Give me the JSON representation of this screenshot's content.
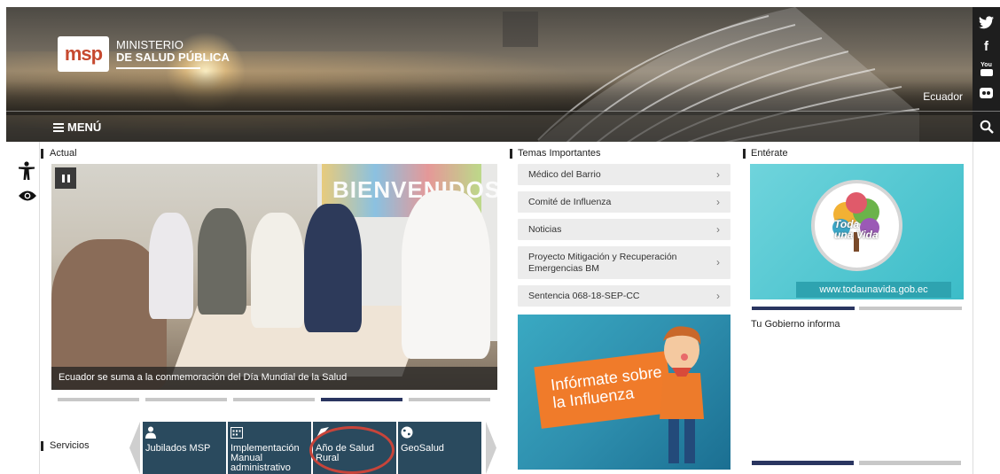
{
  "header": {
    "logo_mark": "msp",
    "org_line1": "MINISTERIO",
    "org_line2": "DE SALUD PÚBLICA",
    "country": "Ecuador",
    "menu_label": "MENÚ"
  },
  "social": {
    "icons": [
      "twitter-icon",
      "facebook-icon",
      "youtube-icon",
      "flickr-icon",
      "search-icon"
    ],
    "youtube_text": "You"
  },
  "sections": {
    "actual": "Actual",
    "servicios": "Servicios",
    "temas": "Temas Importantes",
    "enterate": "Entérate",
    "gobierno": "Tu Gobierno informa"
  },
  "slider": {
    "caption": "Ecuador se suma a la conmemoración del Día Mundial de la Salud",
    "banner_text": "BIENVENIDOS",
    "dots_total": 5,
    "active_dot": 4
  },
  "services": [
    {
      "label": "Jubilados MSP",
      "icon": "person-icon"
    },
    {
      "label": "Implementación Manual administrativo",
      "icon": "calendar-icon"
    },
    {
      "label": "Año de Salud Rural",
      "icon": "flag-icon"
    },
    {
      "label": "GeoSalud",
      "icon": "globe-icon"
    }
  ],
  "temas": [
    {
      "label": "Médico del Barrio"
    },
    {
      "label": "Comité de Influenza"
    },
    {
      "label": "Noticias"
    },
    {
      "label": "Proyecto Mitigación y Recuperación Emergencias BM"
    },
    {
      "label": "Sentencia 068-18-SEP-CC"
    }
  ],
  "influenza": {
    "line1": "Infórmate sobre",
    "line2": "la Influenza"
  },
  "enterate": {
    "logo_line1": "Toda",
    "logo_line2": "una Vida",
    "url": "www.todaunavida.gob.ec"
  },
  "colors": {
    "accent_dark": "#2a3560",
    "service_tile": "#2a4a5e",
    "highlight_ring": "#c8443a",
    "influenza_orange": "#f07b2a"
  }
}
